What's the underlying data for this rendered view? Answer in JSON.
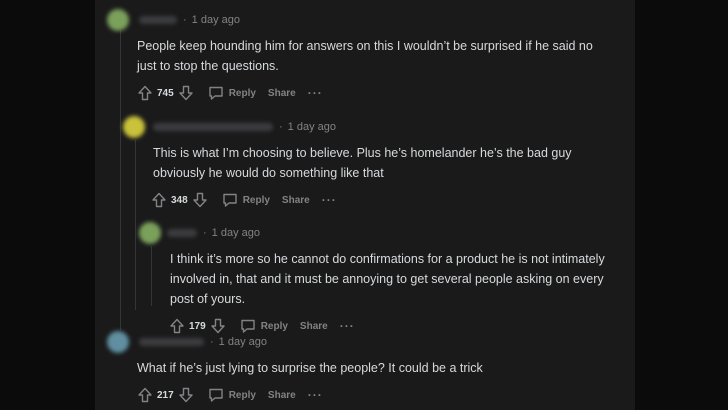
{
  "comments": [
    {
      "time": "1 day ago",
      "body": "People keep hounding him for answers on this I wouldn’t be surprised if he said no just to stop the questions.",
      "score": "745",
      "avatar_color": "#7ba05b"
    },
    {
      "time": "1 day ago",
      "body": "This is what I’m choosing to believe. Plus he’s homelander he’s the bad guy obviously he would do something like that",
      "score": "348",
      "avatar_color": "#c9c23a"
    },
    {
      "time": "1 day ago",
      "body": "I think it’s more so he cannot do confirmations for a product he is not intimately involved in, that and it must be annoying to get several people asking on every post of yours.",
      "score": "179",
      "avatar_color": "#7ba05b"
    },
    {
      "time": "1 day ago",
      "body": "What if he’s just lying to surprise the people? It could be a trick",
      "score": "217",
      "avatar_color": "#5f8fa0"
    }
  ],
  "actions": {
    "reply_label": "Reply",
    "share_label": "Share",
    "more_label": "···",
    "separator": "·"
  },
  "icons": {
    "upvote": "upvote-arrow-icon",
    "downvote": "downvote-arrow-icon",
    "reply": "speech-bubble-icon",
    "more": "more-dots-icon"
  }
}
